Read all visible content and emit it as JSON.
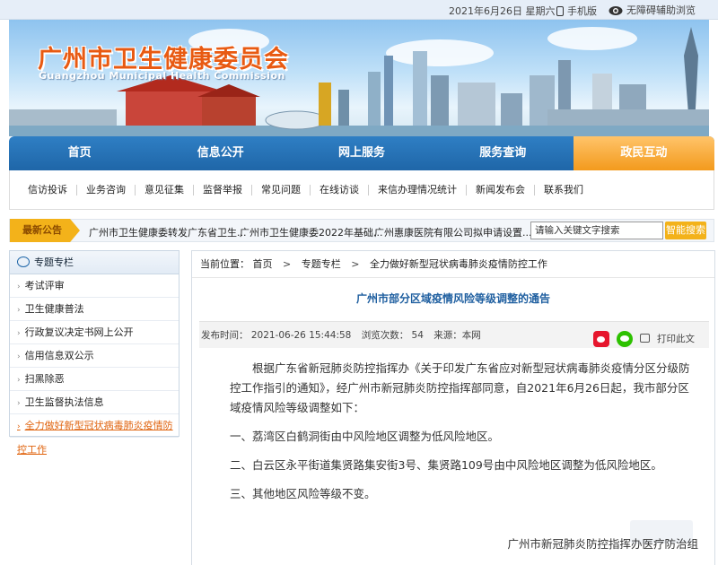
{
  "topbar": {
    "date": "2021年6月26日  星期六",
    "mobile": "手机版",
    "accessibility": "无障碍辅助浏览"
  },
  "banner": {
    "title_cn": "广州市卫生健康委员会",
    "title_en": "Guangzhou Municipal Health Commission"
  },
  "nav": {
    "items": [
      "首页",
      "信息公开",
      "网上服务",
      "服务查询",
      "政民互动"
    ],
    "active_index": 4
  },
  "subnav": {
    "items": [
      "信访投诉",
      "业务咨询",
      "意见征集",
      "监督举报",
      "常见问题",
      "在线访谈",
      "来信办理情况统计",
      "新闻发布会",
      "联系我们"
    ]
  },
  "notice": {
    "label": "最新公告",
    "items": [
      "广州市卫生健康委转发广东省卫生...",
      "广州市卫生健康委2022年基础...",
      "广州惠康医院有限公司拟申请设置..."
    ],
    "search_placeholder": "请输入关键文字搜索",
    "search_button": "智能搜索"
  },
  "sidebar": {
    "title": "专题专栏",
    "items": [
      "考试评审",
      "卫生健康普法",
      "行政复议决定书网上公开",
      "信用信息双公示",
      "扫黑除恶",
      "卫生监督执法信息",
      "全力做好新型冠状病毒肺炎疫情防控工作"
    ],
    "active_index": 6
  },
  "breadcrumb": {
    "prefix": "当前位置：",
    "items": [
      "首页",
      "专题专栏",
      "全力做好新型冠状病毒肺炎疫情防控工作"
    ],
    "separator": ">"
  },
  "article": {
    "title": "广州市部分区域疫情风险等级调整的通告",
    "publish_time": "发布时间：  2021-06-26 15:44:58",
    "views": "浏览次数：  54",
    "source": "来源：本网",
    "print_label": "打印此文",
    "paragraphs": [
      "根据广东省新冠肺炎防控指挥办《关于印发广东省应对新型冠状病毒肺炎疫情分区分级防控工作指引的通知》，经广州市新冠肺炎防控指挥部同意，自2021年6月26日起，我市部分区域疫情风险等级调整如下：",
      "一、荔湾区白鹤洞街由中风险地区调整为低风险地区。",
      "二、白云区永平街道集贤路集安街3号、集贤路109号由中风险地区调整为低风险地区。",
      "三、其他地区风险等级不变。"
    ],
    "signature": "广州市新冠肺炎防控指挥办医疗防治组"
  },
  "colors": {
    "nav_blue": "#1f66a8",
    "nav_active_orange": "#f39a1d",
    "banner_title": "#e85a12",
    "article_title": "#1f5fa0",
    "notice_label": "#f3b21a"
  }
}
